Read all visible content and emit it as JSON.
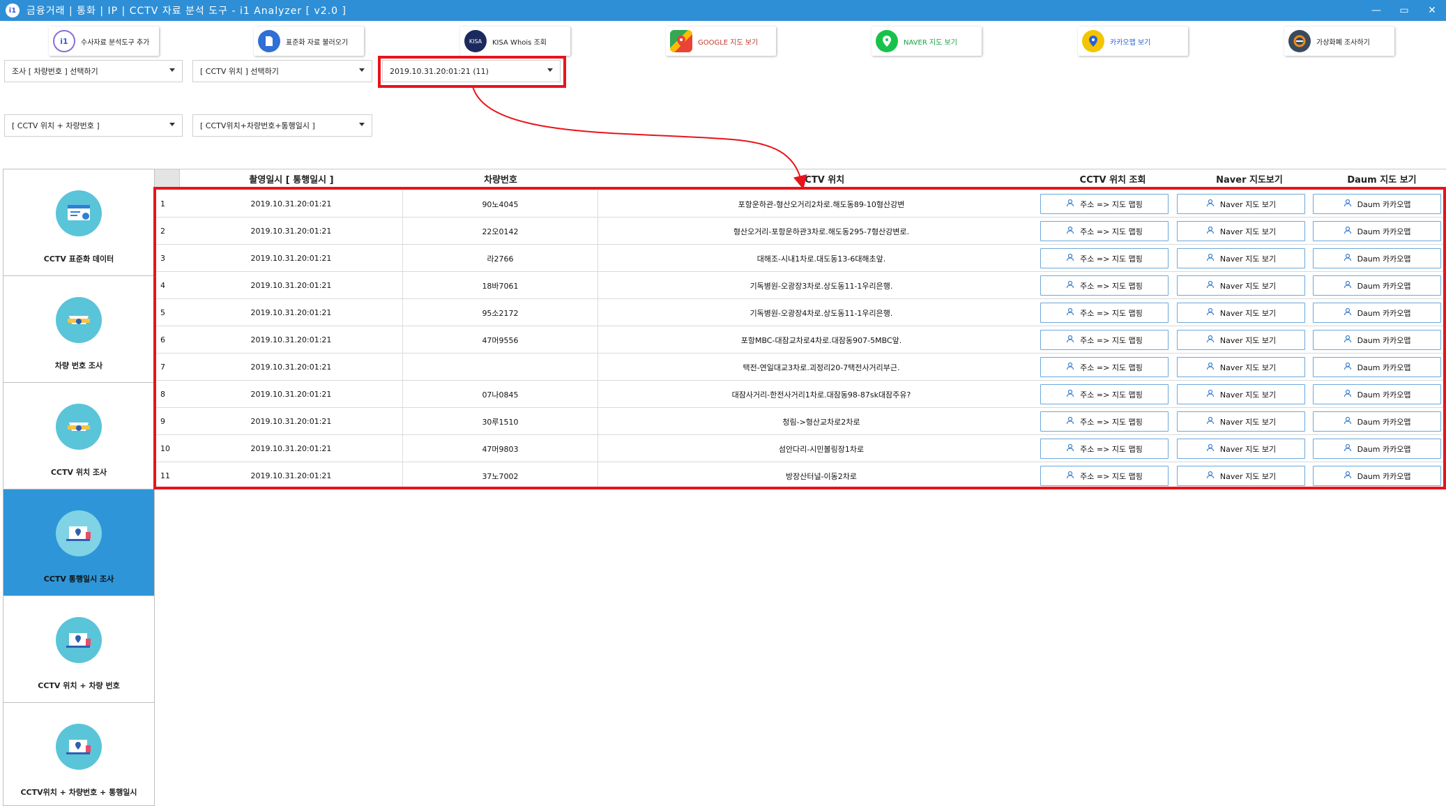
{
  "window": {
    "title": "금융거래 | 통화 | IP | CCTV 자료 분석 도구 - i1 Analyzer [ v2.0 ]",
    "controls": [
      "—",
      "▭",
      "✕"
    ]
  },
  "toolbar": [
    {
      "label": "수사자료 분석도구 추가",
      "icon": "i1-logo-icon",
      "color": "#ffffff"
    },
    {
      "label": "표준화 자료 불러오기",
      "icon": "document-icon",
      "color": "#2f6fd6"
    },
    {
      "label": "KISA Whois 조회",
      "icon": "kisa-icon",
      "color": "#1b2a5e"
    },
    {
      "label": "GOOGLE 지도 보기",
      "icon": "google-maps-icon",
      "color": "#4caf50"
    },
    {
      "label": "NAVER 지도 보기",
      "icon": "naver-map-pin-icon",
      "color": "#18c24a"
    },
    {
      "label": "카카오맵 보기",
      "icon": "kakao-map-pin-icon",
      "color": "#f5c400"
    },
    {
      "label": "가상화폐 조사하기",
      "icon": "crypto-icon",
      "color": "#3a4a5c"
    }
  ],
  "filters": {
    "survey_select": "조사 [ 차량번호 ] 선택하기",
    "cctv_location_select": "[ CCTV 위치 ] 선택하기",
    "datetime_select": "2019.10.31.20:01:21 (11)",
    "cctv_plate_select": "[ CCTV 위치 + 차량번호 ]",
    "cctv_plate_time_select": "[ CCTV위치+차량번호+통행일시 ]"
  },
  "sidebar": [
    {
      "label": "CCTV 표준화 데이터",
      "icon": "cctv-data-icon",
      "active": false
    },
    {
      "label": "차량 번호 조사",
      "icon": "vehicle-number-icon",
      "active": false
    },
    {
      "label": "CCTV 위치 조사",
      "icon": "cctv-location-icon",
      "active": false
    },
    {
      "label": "CCTV 통행일시 조사",
      "icon": "cctv-time-icon",
      "active": true
    },
    {
      "label": "CCTV 위치 + 차량 번호",
      "icon": "cctv-location-plate-icon",
      "active": false
    },
    {
      "label": "CCTV위치 + 차량번호 + 통행일시",
      "icon": "cctv-location-plate-time-icon",
      "active": false
    }
  ],
  "table": {
    "headers": [
      "촬영일시 [ 통행일시 ]",
      "차량번호",
      "CCTV 위치",
      "CCTV 위치 조회",
      "Naver 지도보기",
      "Daum 지도 보기"
    ],
    "button_labels": {
      "cctv": "주소 => 지도 맵핑",
      "naver": "Naver 지도 보기",
      "daum": "Daum 카카오맵"
    },
    "rows": [
      {
        "no": "1",
        "datetime": "2019.10.31.20:01:21",
        "plate": "90노4045",
        "location": "포항운하관-형산오거리2차로.해도동89-10형산강변"
      },
      {
        "no": "2",
        "datetime": "2019.10.31.20:01:21",
        "plate": "22오0142",
        "location": "형산오거리-포항운하관3차로.해도동295-7형산강변로."
      },
      {
        "no": "3",
        "datetime": "2019.10.31.20:01:21",
        "plate": "라2766",
        "location": "대해조-시내1차로.대도동13-6대해초앞."
      },
      {
        "no": "4",
        "datetime": "2019.10.31.20:01:21",
        "plate": "18바7061",
        "location": "기독병원-오광장3차로.상도동11-1우리은행."
      },
      {
        "no": "5",
        "datetime": "2019.10.31.20:01:21",
        "plate": "95소2172",
        "location": "기독병원-오광장4차로.상도동11-1우리은행."
      },
      {
        "no": "6",
        "datetime": "2019.10.31.20:01:21",
        "plate": "47머9556",
        "location": "포항MBC-대잠교차로4차로.대잠동907-5MBC앞."
      },
      {
        "no": "7",
        "datetime": "2019.10.31.20:01:21",
        "plate": "",
        "location": "택전-연일대교3차로.괴정리20-7택전사거리부근."
      },
      {
        "no": "8",
        "datetime": "2019.10.31.20:01:21",
        "plate": "07나0845",
        "location": "대잠사거리-한전사거리1차로.대잠동98-87sk대잠주유?"
      },
      {
        "no": "9",
        "datetime": "2019.10.31.20:01:21",
        "plate": "30루1510",
        "location": "청림->형산교차로2차로"
      },
      {
        "no": "10",
        "datetime": "2019.10.31.20:01:21",
        "plate": "47머9803",
        "location": "섬안다리-시민볼링장1차로"
      },
      {
        "no": "11",
        "datetime": "2019.10.31.20:01:21",
        "plate": "37노7002",
        "location": "방장산터널-이동2차로"
      }
    ]
  },
  "annotations": {
    "highlight_color": "#e8141b"
  }
}
